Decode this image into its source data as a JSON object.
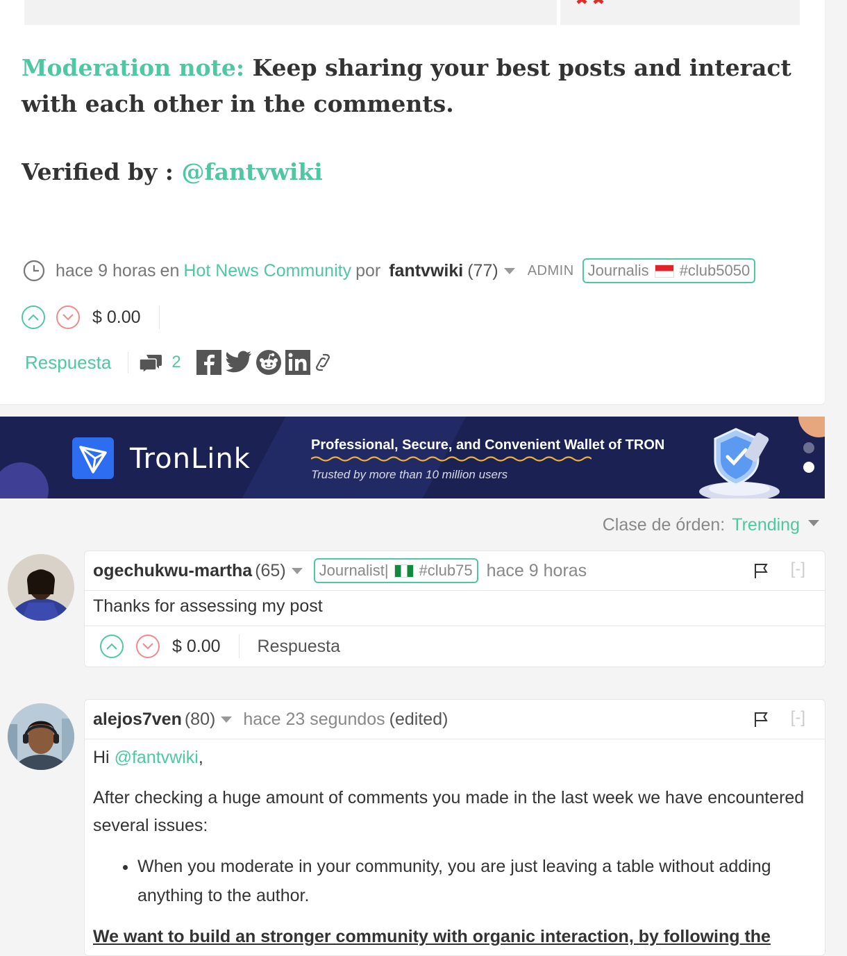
{
  "post": {
    "mod_note_label": "Moderation note:",
    "mod_note_text": " Keep sharing your best posts and interact with each other in the comments.",
    "verified_label": "Verified by : ",
    "verified_user": "@fantvwiki",
    "meta": {
      "time": "hace 9 horas",
      "en": "en",
      "community": "Hot News Community",
      "por": "por",
      "author": "fantvwiki",
      "reputation": "(77)",
      "role": "ADMIN",
      "badge_text": "Journalis",
      "badge_tag": "#club5050"
    },
    "payout": "$ 0.00",
    "reply_label": "Respuesta",
    "comment_count": "2",
    "share_icons": [
      "facebook-icon",
      "twitter-icon",
      "reddit-icon",
      "linkedin-icon",
      "link-icon"
    ]
  },
  "banner": {
    "brand": "TronLink",
    "headline": "Professional, Secure, and Convenient Wallet of TRON",
    "subline": "Trusted by more than 10 million users"
  },
  "sort": {
    "label": "Clase de órden:",
    "value": "Trending"
  },
  "comments": [
    {
      "author": "ogechukwu-martha",
      "reputation": "(65)",
      "badge_text": "Journalist|",
      "badge_tag": "#club75",
      "time": "hace 9 horas",
      "collapse": "[-]",
      "body": "Thanks for assessing my post",
      "payout": "$ 0.00",
      "reply_label": "Respuesta"
    },
    {
      "author": "alejos7ven",
      "reputation": "(80)",
      "time": "hace 23 segundos",
      "edited": "(edited)",
      "collapse": "[-]",
      "greeting": "Hi ",
      "mention": "@fantvwiki",
      "greeting_end": ",",
      "paragraph1": "After checking a huge amount of comments you made in the last week we have encountered several issues:",
      "bullet1": "When you moderate in your community, you are just leaving a table without adding anything to the author.",
      "paragraph2_partial": "We want to build an stronger community with organic interaction, by following the"
    }
  ],
  "colors": {
    "accent": "#4fc7a0",
    "downvote": "#f08a8a",
    "banner_bg": "#1c2153",
    "tron_blue": "#2c6df2"
  }
}
